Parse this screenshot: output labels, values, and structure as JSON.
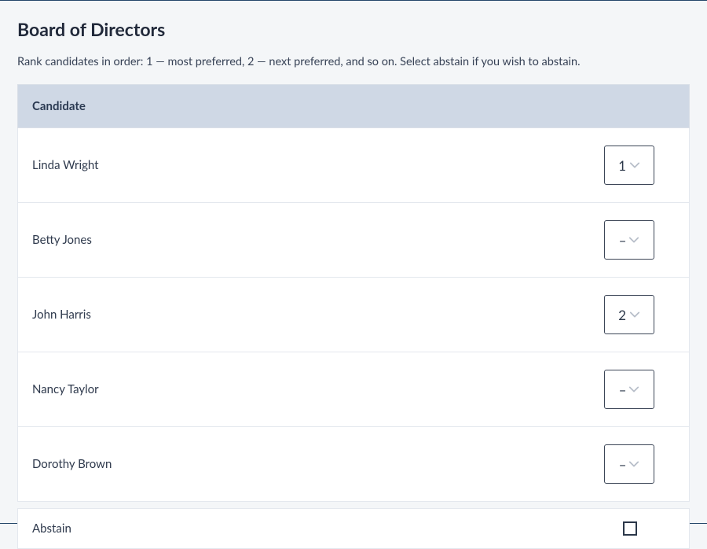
{
  "title": "Board of Directors",
  "instructions": "Rank candidates in order: 1 — most preferred, 2 — next preferred, and so on. Select abstain if you wish to abstain.",
  "table": {
    "header": "Candidate",
    "placeholder": "–",
    "candidates": [
      {
        "name": "Linda Wright",
        "rank": "1"
      },
      {
        "name": "Betty Jones",
        "rank": "–"
      },
      {
        "name": "John Harris",
        "rank": "2"
      },
      {
        "name": "Nancy Taylor",
        "rank": "–"
      },
      {
        "name": "Dorothy Brown",
        "rank": "–"
      }
    ]
  },
  "abstain": {
    "label": "Abstain",
    "checked": false
  },
  "colors": {
    "headerBg": "#cfd8e5",
    "border": "#e4e8ee",
    "ruleLine": "#25476a",
    "text": "#2b3749"
  }
}
